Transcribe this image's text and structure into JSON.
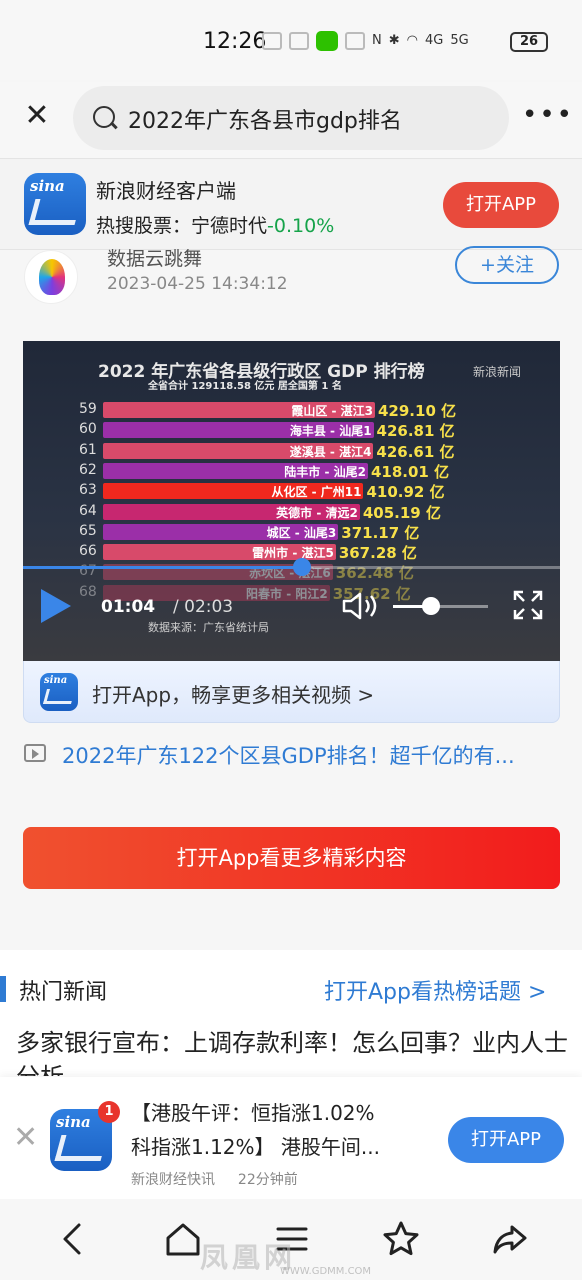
{
  "status_bar": {
    "time": "12:26",
    "network": "4G",
    "network2": "5G",
    "battery": "26"
  },
  "search": {
    "query": "2022年广东各县市gdp排名"
  },
  "app_banner": {
    "title": "新浪财经客户端",
    "sub_prefix": "热搜股票：",
    "stock": "宁德时代",
    "change": "-0.10%",
    "button": "打开APP"
  },
  "article": {
    "author": "数据云跳舞",
    "time": "2023-04-25 14:34:12",
    "follow": "+关注"
  },
  "video": {
    "title": "2022 年广东省各县级行政区 GDP 排行榜",
    "subtitle": "全省合计 129118.58 亿元 居全国第 1 名",
    "watermark": "新浪新闻",
    "current_time": "01:04",
    "total_time": "/ 02:03",
    "source": "数据来源：广东省统计局",
    "progress": 0.52,
    "volume": 0.4,
    "rows": [
      {
        "rank": "59",
        "name": "霞山区 - 湛江3",
        "value": "429.10 亿",
        "color": "#d84a6a"
      },
      {
        "rank": "60",
        "name": "海丰县 - 汕尾1",
        "value": "426.81 亿",
        "color": "#9b2fa8"
      },
      {
        "rank": "61",
        "name": "遂溪县 - 湛江4",
        "value": "426.61 亿",
        "color": "#d84a6a"
      },
      {
        "rank": "62",
        "name": "陆丰市 - 汕尾2",
        "value": "418.01 亿",
        "color": "#9b2fa8"
      },
      {
        "rank": "63",
        "name": "从化区 - 广州11",
        "value": "410.92 亿",
        "color": "#f0281e"
      },
      {
        "rank": "64",
        "name": "英德市 - 清远2",
        "value": "405.19 亿",
        "color": "#c72770"
      },
      {
        "rank": "65",
        "name": "城区 - 汕尾3",
        "value": "371.17 亿",
        "color": "#9b2fa8"
      },
      {
        "rank": "66",
        "name": "雷州市 - 湛江5",
        "value": "367.28 亿",
        "color": "#d84a6a"
      },
      {
        "rank": "67",
        "name": "赤坎区 - 湛江6",
        "value": "362.48 亿",
        "color": "#d84a6a"
      },
      {
        "rank": "68",
        "name": "阳春市 - 阳江2",
        "value": "357.62 亿",
        "color": "#b83a5a"
      }
    ],
    "open_app": "打开App，畅享更多相关视频 >"
  },
  "related": {
    "text": "2022年广东122个区县GDP排名！超千亿的有..."
  },
  "big_button": "打开App看更多精彩内容",
  "hot": {
    "title": "热门新闻",
    "link": "打开App看热榜话题 >",
    "headline": "多家银行宣布：上调存款利率！怎么回事？业内人士分析"
  },
  "notification": {
    "badge": "1",
    "line1": "【港股午评：恒指涨1.02%",
    "line2": "科指涨1.12%】 港股午间...",
    "source": "新浪财经快讯",
    "ago": "22分钟前",
    "button": "打开APP"
  },
  "watermark": {
    "text": "凤凰网",
    "url": "WWW.GDMM.COM"
  },
  "colors": {
    "accent_red": "#e84a3c",
    "accent_blue": "#3a86e8",
    "link_blue": "#2f7bd3"
  }
}
